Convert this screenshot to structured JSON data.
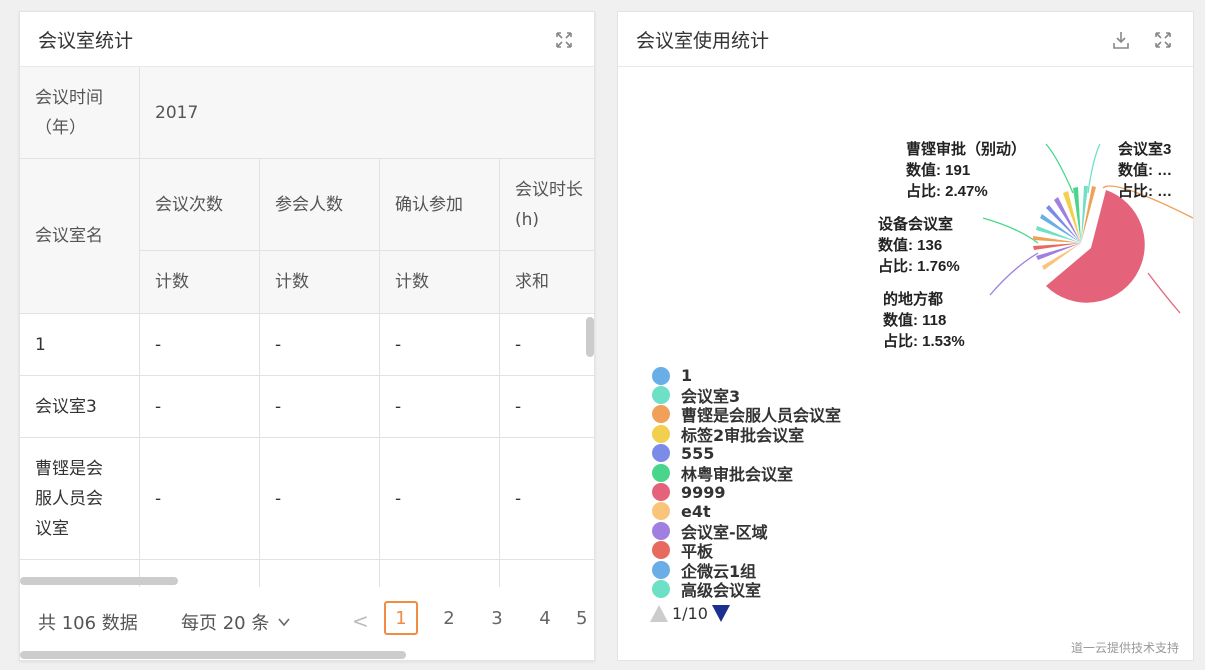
{
  "left_panel": {
    "title": "会议室统计",
    "table": {
      "time_header": "会议时间\n（年）",
      "year": "2017",
      "room_header": "会议室名",
      "columns": [
        "会议次数",
        "参会人数",
        "确认参加",
        "会议时长\n(h)"
      ],
      "aggregates": [
        "计数",
        "计数",
        "计数",
        "求和"
      ],
      "rows": [
        {
          "name": "1",
          "values": [
            "-",
            "-",
            "-",
            "-"
          ]
        },
        {
          "name": "会议室3",
          "values": [
            "-",
            "-",
            "-",
            "-"
          ]
        },
        {
          "name": "曹铿是会\n服人员会\n议室",
          "values": [
            "-",
            "-",
            "-",
            "-"
          ]
        }
      ]
    },
    "pager": {
      "total": "共 106 数据",
      "page_size": "每页 20 条",
      "prev": "<",
      "pages": [
        "1",
        "2",
        "3",
        "4",
        "5"
      ],
      "current": "1"
    }
  },
  "right_panel": {
    "title": "会议室使用统计",
    "chart_data": {
      "type": "pie",
      "labels": [
        {
          "name": "曹铿审批（别动）",
          "value": "数值: 191",
          "pct": "占比: 2.47%"
        },
        {
          "name": "会议室3",
          "value": "数值: …",
          "pct": "占比: …"
        },
        {
          "name": "设备会议室",
          "value": "数值: 136",
          "pct": "占比: 1.76%"
        },
        {
          "name": "的地方都",
          "value": "数值: 118",
          "pct": "占比: 1.53%"
        }
      ],
      "slices": [
        {
          "name": "9999",
          "pct": 62,
          "color": "#e5627b"
        },
        {
          "name": "曹铿审批（别动）",
          "pct": 2.47,
          "color": "#49d68b"
        },
        {
          "name": "设备会议室",
          "pct": 1.76,
          "color": "#49d68b"
        },
        {
          "name": "的地方都",
          "pct": 1.53,
          "color": "#a07fe0"
        }
      ]
    },
    "legend": [
      {
        "label": "1",
        "color": "#6aaee8"
      },
      {
        "label": "会议室3",
        "color": "#6ee0c6"
      },
      {
        "label": "曹铿是会服人员会议室",
        "color": "#f0a058"
      },
      {
        "label": "标签2审批会议室",
        "color": "#f2cf4f"
      },
      {
        "label": "555",
        "color": "#7c8ae8"
      },
      {
        "label": "林粤审批会议室",
        "color": "#49d68b"
      },
      {
        "label": "9999",
        "color": "#e5627b"
      },
      {
        "label": "e4t",
        "color": "#f9c57a"
      },
      {
        "label": "会议室-区域",
        "color": "#a07fe0"
      },
      {
        "label": "平板",
        "color": "#e86a5e"
      },
      {
        "label": "企微云1组",
        "color": "#6aaee8"
      },
      {
        "label": "高级会议室",
        "color": "#6ee0c6"
      }
    ],
    "legend_page": "1/10",
    "footer": "道一云提供技术支持"
  }
}
